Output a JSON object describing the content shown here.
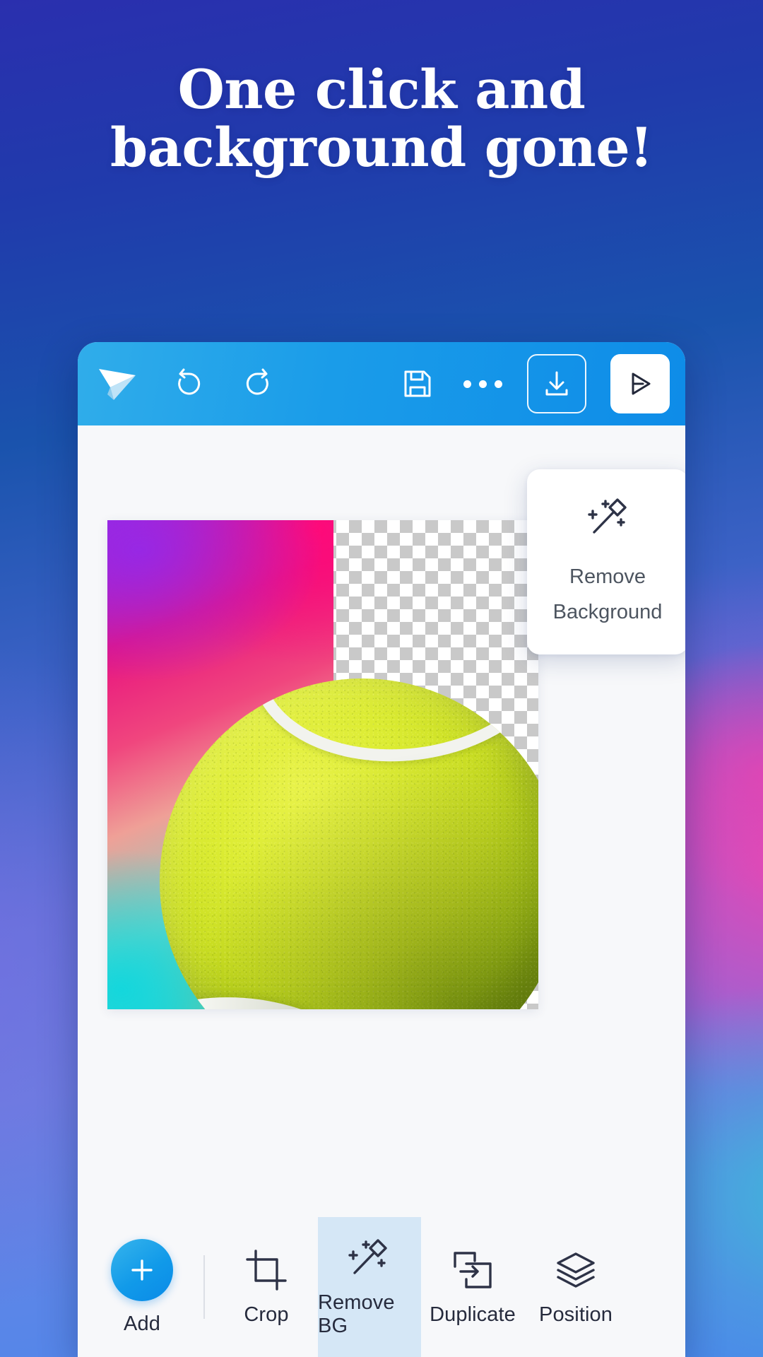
{
  "headline": {
    "line1": "One click and",
    "line2": "background gone!"
  },
  "colors": {
    "bg_top": "#2a2fae",
    "bg_mid": "#3f63c8",
    "bg_bottom": "#4b86ea",
    "accent_pink": "#eb46b4",
    "accent_teal": "#3cbed7",
    "toolbar_blue_start": "#30adea",
    "toolbar_blue_end": "#0e8ce8",
    "canvas_bg": "#f7f8fa",
    "active_tool_bg": "#d5e7f6",
    "icon_dark": "#2e3347",
    "tooltip_text": "#4d5560"
  },
  "toolbar": {
    "logo": "paper-plane-logo-icon",
    "undo_label": "undo-icon",
    "redo_label": "redo-icon",
    "save_label": "save-floppy-icon",
    "more_label": "more-options-icon",
    "download_label": "download-icon",
    "share_label": "share-send-icon"
  },
  "tooltip": {
    "icon": "magic-wand-icon",
    "line1": "Remove",
    "line2": "Background"
  },
  "canvas": {
    "artwork": "tennis-ball-on-gradient",
    "transparency_pattern": "checkerboard"
  },
  "bottom_bar": {
    "items": [
      {
        "label": "Add",
        "icon": "plus-icon",
        "active": false
      },
      {
        "label": "Crop",
        "icon": "crop-icon",
        "active": false
      },
      {
        "label": "Remove BG",
        "icon": "magic-wand-icon",
        "active": true
      },
      {
        "label": "Duplicate",
        "icon": "duplicate-icon",
        "active": false
      },
      {
        "label": "Position",
        "icon": "layers-icon",
        "active": false
      }
    ]
  }
}
